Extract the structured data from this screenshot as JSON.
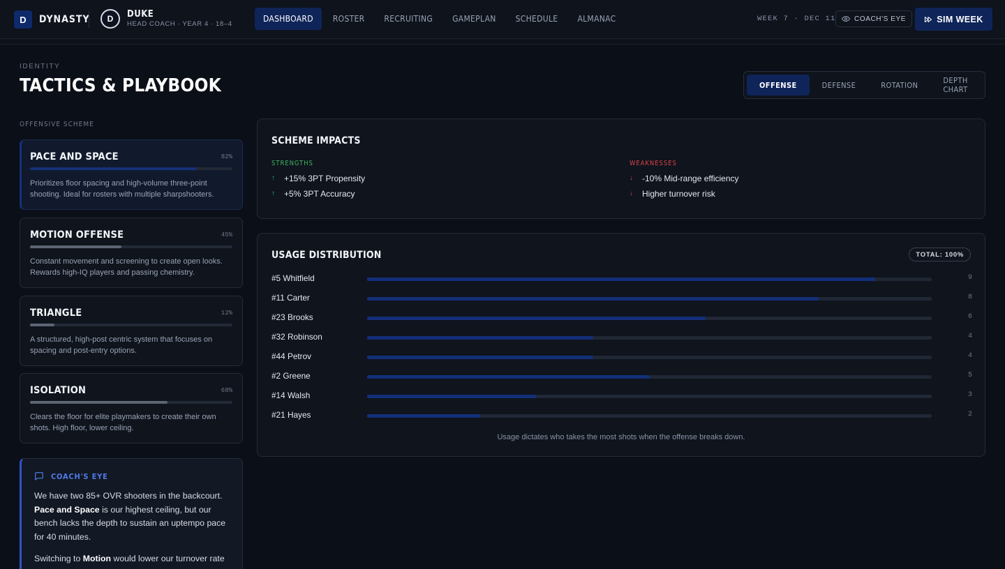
{
  "app": {
    "logo_letter": "D",
    "name": "DYNASTY",
    "team_letter": "D",
    "team_name": "DUKE",
    "team_sub": "HEAD COACH · YEAR 4 · 18–4"
  },
  "nav": [
    {
      "label": "DASHBOARD",
      "active": true
    },
    {
      "label": "ROSTER",
      "active": false
    },
    {
      "label": "RECRUITING",
      "active": false
    },
    {
      "label": "GAMEPLAN",
      "active": false
    },
    {
      "label": "SCHEDULE",
      "active": false
    },
    {
      "label": "ALMANAC",
      "active": false
    }
  ],
  "topbar_right": {
    "week": "WEEK 7 · DEC 11",
    "coach_eye_label": "COACH'S EYE",
    "sim_label": "SIM WEEK"
  },
  "header": {
    "eyebrow": "IDENTITY",
    "title": "TACTICS & PLAYBOOK"
  },
  "tabs": [
    {
      "label": "OFFENSE",
      "active": true
    },
    {
      "label": "DEFENSE",
      "active": false
    },
    {
      "label": "ROTATION",
      "active": false
    },
    {
      "label": "DEPTH CHART",
      "active": false
    }
  ],
  "schemes": {
    "label": "OFFENSIVE SCHEME",
    "items": [
      {
        "name": "PACE AND SPACE",
        "pct_label": "82%",
        "fit": 0.82,
        "active": true,
        "desc": "Prioritizes floor spacing and high-volume three-point shooting. Ideal for rosters with multiple sharpshooters."
      },
      {
        "name": "MOTION OFFENSE",
        "pct_label": "45%",
        "fit": 0.45,
        "active": false,
        "desc": "Constant movement and screening to create open looks. Rewards high-IQ players and passing chemistry."
      },
      {
        "name": "TRIANGLE",
        "pct_label": "12%",
        "fit": 0.12,
        "active": false,
        "desc": "A structured, high-post centric system that focuses on spacing and post-entry options."
      },
      {
        "name": "ISOLATION",
        "pct_label": "68%",
        "fit": 0.68,
        "active": false,
        "desc": "Clears the floor for elite playmakers to create their own shots. High floor, lower ceiling."
      }
    ]
  },
  "coach_eye": {
    "title": "COACH'S EYE",
    "p1_a": "We have two 85+ OVR shooters in the backcourt. ",
    "p1_b": "Pace and Space",
    "p1_c": " is our highest ceiling, but our bench lacks the depth to sustain an uptempo pace for 40 minutes.",
    "p2_a": "Switching to ",
    "p2_b": "Motion",
    "p2_c": " would lower our turnover rate"
  },
  "impacts": {
    "title": "SCHEME IMPACTS",
    "strengths_label": "STRENGTHS",
    "strengths": [
      "+15% 3PT Propensity",
      "+5% 3PT Accuracy"
    ],
    "weaknesses_label": "WEAKNESSES",
    "weaknesses": [
      "-10% Mid-range efficiency",
      "Higher turnover risk"
    ]
  },
  "usage": {
    "title": "USAGE DISTRIBUTION",
    "total_label": "TOTAL: 100%",
    "max": 10,
    "players": [
      {
        "name": "#5 Whitfield",
        "value": 9
      },
      {
        "name": "#11 Carter",
        "value": 8
      },
      {
        "name": "#23 Brooks",
        "value": 6
      },
      {
        "name": "#32 Robinson",
        "value": 4
      },
      {
        "name": "#44 Petrov",
        "value": 4
      },
      {
        "name": "#2 Greene",
        "value": 5
      },
      {
        "name": "#14 Walsh",
        "value": 3
      },
      {
        "name": "#21 Hayes",
        "value": 2
      }
    ],
    "footnote": "Usage dictates who takes the most shots when the offense breaks down."
  }
}
